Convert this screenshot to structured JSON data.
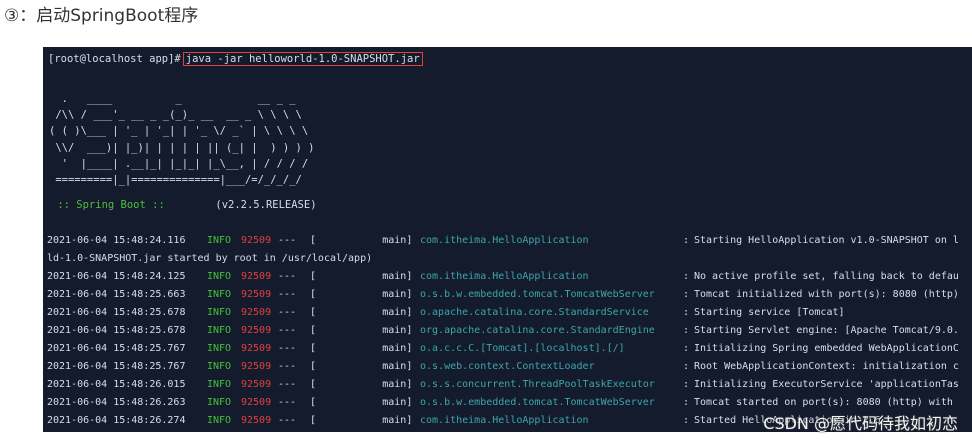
{
  "heading": "③：启动SpringBoot程序",
  "terminal": {
    "prompt": "[root@localhost app]#",
    "command": "java -jar helloworld-1.0-SNAPSHOT.jar",
    "banner": "  .   ____          _            __ _ _\n /\\\\ / ___'_ __ _ _(_)_ __  __ _ \\ \\ \\ \\\n( ( )\\___ | '_ | '_| | '_ \\/ _` | \\ \\ \\ \\\n \\\\/  ___)| |_)| | | | | || (_| |  ) ) ) )\n  '  |____| .__|_| |_|_| |_\\__, | / / / /\n =========|_|==============|___/=/_/_/_/",
    "spring_label": " :: Spring Boot :: ",
    "spring_version": "(v2.2.5.RELEASE)",
    "logs": [
      {
        "ts": "2021-06-04 15:48:24.116",
        "level": "INFO",
        "pid": "92509",
        "dash": "---",
        "thread": "[           main]",
        "logger": "com.itheima.HelloApplication",
        "msg": "Starting HelloApplication v1.0-SNAPSHOT on l"
      },
      {
        "wrap": "ld-1.0-SNAPSHOT.jar started by root in /usr/local/app)"
      },
      {
        "ts": "2021-06-04 15:48:24.125",
        "level": "INFO",
        "pid": "92509",
        "dash": "---",
        "thread": "[           main]",
        "logger": "com.itheima.HelloApplication",
        "msg": "No active profile set, falling back to defau"
      },
      {
        "ts": "2021-06-04 15:48:25.663",
        "level": "INFO",
        "pid": "92509",
        "dash": "---",
        "thread": "[           main]",
        "logger": "o.s.b.w.embedded.tomcat.TomcatWebServer",
        "msg": "Tomcat initialized with port(s): 8080 (http)"
      },
      {
        "ts": "2021-06-04 15:48:25.678",
        "level": "INFO",
        "pid": "92509",
        "dash": "---",
        "thread": "[           main]",
        "logger": "o.apache.catalina.core.StandardService",
        "msg": "Starting service [Tomcat]"
      },
      {
        "ts": "2021-06-04 15:48:25.678",
        "level": "INFO",
        "pid": "92509",
        "dash": "---",
        "thread": "[           main]",
        "logger": "org.apache.catalina.core.StandardEngine",
        "msg": "Starting Servlet engine: [Apache Tomcat/9.0."
      },
      {
        "ts": "2021-06-04 15:48:25.767",
        "level": "INFO",
        "pid": "92509",
        "dash": "---",
        "thread": "[           main]",
        "logger": "o.a.c.c.C.[Tomcat].[localhost].[/]",
        "msg": "Initializing Spring embedded WebApplicationC"
      },
      {
        "ts": "2021-06-04 15:48:25.767",
        "level": "INFO",
        "pid": "92509",
        "dash": "---",
        "thread": "[           main]",
        "logger": "o.s.web.context.ContextLoader",
        "msg": "Root WebApplicationContext: initialization c"
      },
      {
        "ts": "2021-06-04 15:48:26.015",
        "level": "INFO",
        "pid": "92509",
        "dash": "---",
        "thread": "[           main]",
        "logger": "o.s.s.concurrent.ThreadPoolTaskExecutor",
        "msg": "Initializing ExecutorService 'applicationTas"
      },
      {
        "ts": "2021-06-04 15:48:26.263",
        "level": "INFO",
        "pid": "92509",
        "dash": "---",
        "thread": "[           main]",
        "logger": "o.s.b.w.embedded.tomcat.TomcatWebServer",
        "msg": "Tomcat started on port(s): 8080 (http) with"
      },
      {
        "ts": "2021-06-04 15:48:26.274",
        "level": "INFO",
        "pid": "92509",
        "dash": "---",
        "thread": "[           main]",
        "logger": "com.itheima.HelloApplication",
        "msg": "Started HelloApplication in 2.6"
      }
    ]
  },
  "watermark": "CSDN @愿代码待我如初恋"
}
